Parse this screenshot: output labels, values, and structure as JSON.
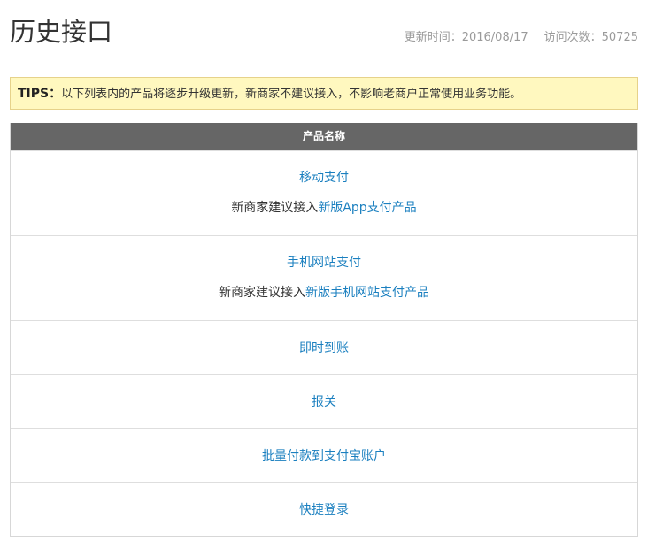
{
  "header": {
    "title": "历史接口",
    "updated_label": "更新时间：2016/08/17",
    "visits_label": "访问次数：50725"
  },
  "tips": {
    "label": "TIPS：",
    "text": "以下列表内的产品将逐步升级更新，新商家不建议接入，不影响老商户正常使用业务功能。"
  },
  "table": {
    "header": "产品名称",
    "rows": [
      {
        "product": "移动支付",
        "note_prefix": "新商家建议接入",
        "note_link": "新版App支付产品"
      },
      {
        "product": "手机网站支付",
        "note_prefix": "新商家建议接入",
        "note_link": "新版手机网站支付产品"
      },
      {
        "product": "即时到账"
      },
      {
        "product": "报关"
      },
      {
        "product": "批量付款到支付宝账户"
      },
      {
        "product": "快捷登录"
      }
    ]
  },
  "colors": {
    "link": "#1a7fbf",
    "tips_bg": "#fff8bf",
    "table_header_bg": "#666666"
  }
}
